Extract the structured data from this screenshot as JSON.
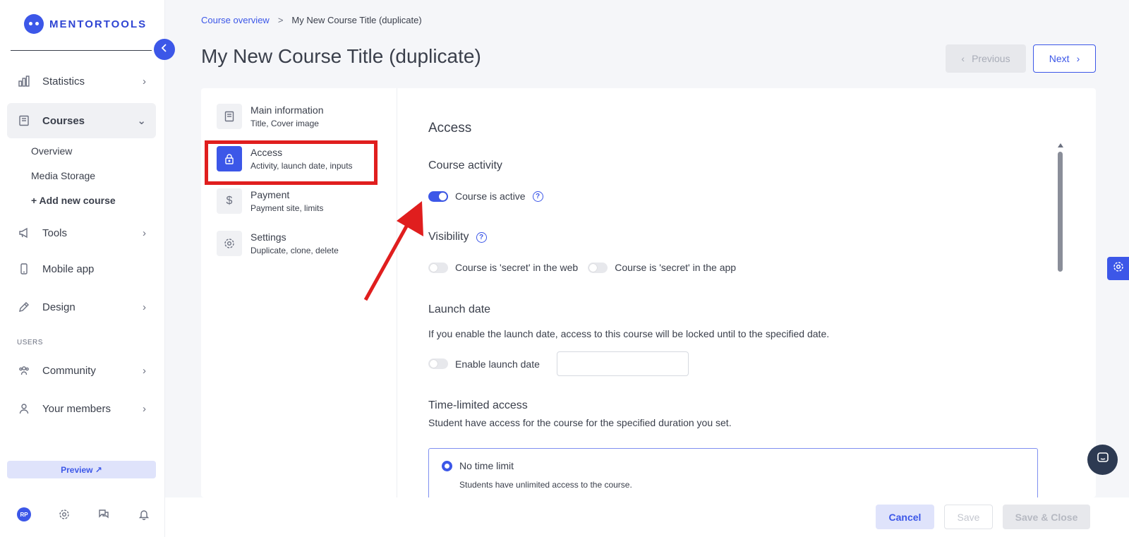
{
  "brand": {
    "name": "MENTORTOOLS"
  },
  "sidebar": {
    "items": [
      {
        "label": "Statistics",
        "icon": "bar-chart-icon"
      },
      {
        "label": "Courses",
        "icon": "book-icon"
      },
      {
        "label": "Tools",
        "icon": "megaphone-icon"
      },
      {
        "label": "Mobile app",
        "icon": "phone-icon"
      },
      {
        "label": "Design",
        "icon": "pencil-icon"
      },
      {
        "label": "Community",
        "icon": "users-icon"
      },
      {
        "label": "Your members",
        "icon": "user-icon"
      }
    ],
    "courses_sub": [
      "Overview",
      "Media Storage",
      "+ Add new course"
    ],
    "section_users": "USERS",
    "preview": "Preview ↗",
    "avatar_initials": "RP"
  },
  "breadcrumb": {
    "link": "Course overview",
    "sep": ">",
    "current": "My New Course Title (duplicate)"
  },
  "page": {
    "title": "My New Course Title (duplicate)"
  },
  "nav_buttons": {
    "previous": "Previous",
    "next": "Next"
  },
  "steps": [
    {
      "title": "Main information",
      "subtitle": "Title, Cover image"
    },
    {
      "title": "Access",
      "subtitle": "Activity, launch date, inputs"
    },
    {
      "title": "Payment",
      "subtitle": "Payment site, limits"
    },
    {
      "title": "Settings",
      "subtitle": "Duplicate, clone, delete"
    }
  ],
  "access": {
    "heading": "Access",
    "course_activity": {
      "heading": "Course activity",
      "toggle_label": "Course is active",
      "on": true
    },
    "visibility": {
      "heading": "Visibility",
      "web_label": "Course is 'secret' in the web",
      "app_label": "Course is 'secret' in the app"
    },
    "launch_date": {
      "heading": "Launch date",
      "description": "If you enable the launch date, access to this course will be locked until to the specified date.",
      "toggle_label": "Enable launch date",
      "value": ""
    },
    "time_limited": {
      "heading": "Time-limited access",
      "description": "Student have access for the course for the specified duration you set.",
      "option_label": "No time limit",
      "option_desc": "Students have unlimited access to the course."
    }
  },
  "footer": {
    "cancel": "Cancel",
    "save": "Save",
    "save_close": "Save & Close"
  },
  "colors": {
    "accent": "#3c57e8",
    "highlight": "#e01e1e"
  }
}
